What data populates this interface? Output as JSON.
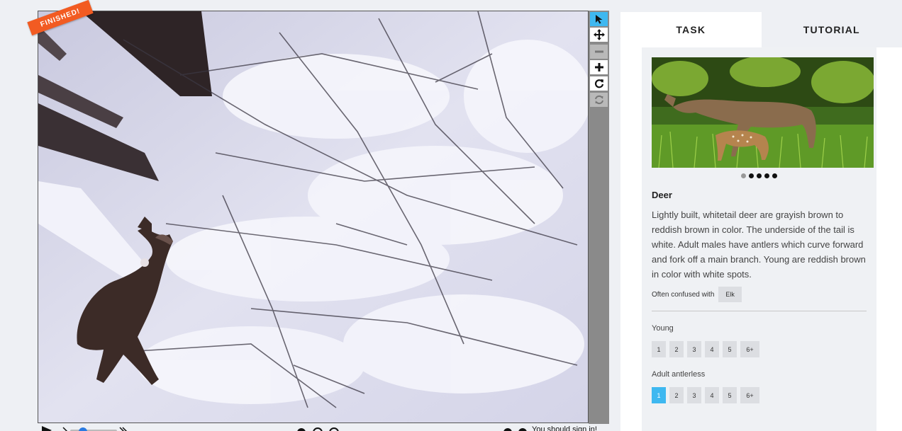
{
  "viewer": {
    "badge": "FINISHED!",
    "status_text": "You should sign in!",
    "colors": {
      "active_tool": "#3eb8f0",
      "badge": "#f25b22"
    },
    "tools": [
      {
        "name": "pointer-icon",
        "state": "active"
      },
      {
        "name": "move-icon",
        "state": "enabled"
      },
      {
        "name": "zoom-out-icon",
        "state": "disabled"
      },
      {
        "name": "zoom-in-icon",
        "state": "enabled"
      },
      {
        "name": "rotate-icon",
        "state": "enabled"
      },
      {
        "name": "reset-icon",
        "state": "disabled"
      }
    ]
  },
  "tabs": [
    {
      "label": "TASK",
      "active": true
    },
    {
      "label": "TUTORIAL",
      "active": false
    }
  ],
  "species": {
    "name": "Deer",
    "description": "Lightly built, whitetail deer are grayish brown to reddish brown in color. The underside of the tail is white. Adult males have antlers which curve forward and fork off a main branch. Young are reddish brown in color with white spots.",
    "confused_label": "Often confused with",
    "confused_with": "Elk",
    "photo_count": 5,
    "current_photo": 1
  },
  "questions": [
    {
      "label": "Young",
      "options": [
        "1",
        "2",
        "3",
        "4",
        "5",
        "6+"
      ],
      "selected": null
    },
    {
      "label": "Adult antlerless",
      "options": [
        "1",
        "2",
        "3",
        "4",
        "5",
        "6+"
      ],
      "selected": "1"
    }
  ]
}
